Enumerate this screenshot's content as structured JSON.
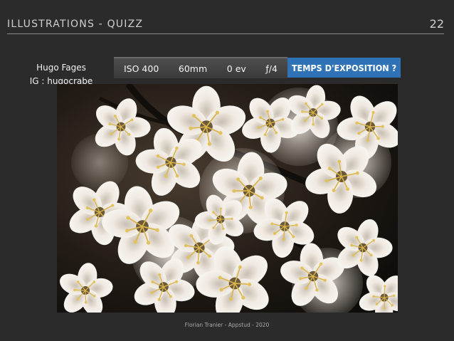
{
  "header": {
    "title": "ILLUSTRATIONS - QUIZZ",
    "page_number": "22"
  },
  "credit": {
    "author": "Hugo Fages",
    "instagram": "IG : hugocrabe"
  },
  "exif": {
    "iso": "ISO 400",
    "focal": "60mm",
    "exposure_comp": "0 ev",
    "aperture": "ƒ/4"
  },
  "question": "TEMPS D'EXPOSITION ?",
  "photo": {
    "subject": "white-blossom-photo",
    "colors": {
      "background": "#1a1612",
      "petal": "#f4f1ec",
      "stamen": "#d9b44a"
    }
  },
  "footer": "Florian Tranier - Appstud - 2020"
}
